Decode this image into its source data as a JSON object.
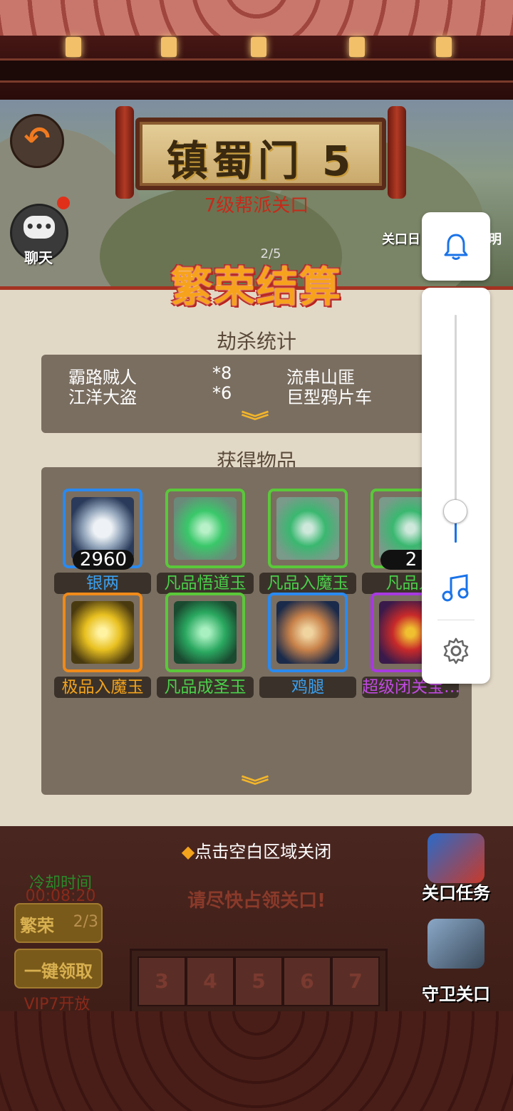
{
  "scene": {
    "banner_title": "镇蜀门 5",
    "banner_subtitle": "7级帮派关口",
    "chat_label": "聊天",
    "progress": "2/5",
    "sidebar_gate": "关口日",
    "sidebar_ming": "明"
  },
  "dialog": {
    "title": "繁荣结算",
    "kill_section_title": "劫杀统计",
    "kills": [
      {
        "name": "霸路贼人",
        "count": "*8"
      },
      {
        "name": "流串山匪",
        "count": ""
      },
      {
        "name": "江洋大盗",
        "count": "*6"
      },
      {
        "name": "巨型鸦片车",
        "count": ""
      }
    ],
    "items_section_title": "获得物品",
    "items": [
      {
        "name": "银两",
        "count": "2960",
        "name_color": "#3aa0f0",
        "frame": "#2a8af0",
        "icon": "silver-ingot-icon"
      },
      {
        "name": "凡品悟道玉",
        "count": "",
        "name_color": "#4ad04a",
        "frame": "#5ac83a",
        "icon": "green-crystal-jade-icon"
      },
      {
        "name": "凡品入魔玉",
        "count": "",
        "name_color": "#4ad04a",
        "frame": "#5ac83a",
        "icon": "green-crescent-jade-icon"
      },
      {
        "name": "凡品入",
        "count": "2",
        "name_color": "#4ad04a",
        "frame": "#5ac83a",
        "icon": "green-crescent-jade-icon"
      },
      {
        "name": "极品入魔玉",
        "count": "",
        "name_color": "#f3a31c",
        "frame": "#f08a1a",
        "icon": "gold-crescent-jade-icon"
      },
      {
        "name": "凡品成圣玉",
        "count": "",
        "name_color": "#4ad04a",
        "frame": "#5ac83a",
        "icon": "green-swirl-jade-icon"
      },
      {
        "name": "鸡腿",
        "count": "",
        "name_color": "#3aa0f0",
        "frame": "#2a8af0",
        "icon": "chicken-leg-icon"
      },
      {
        "name": "超级闭关宝…",
        "count": "",
        "name_color": "#c04ae0",
        "frame": "#a83ae0",
        "icon": "treasure-chest-icon"
      }
    ]
  },
  "bottom": {
    "close_hint_icon": "◆",
    "close_hint": "点击空白区域关闭",
    "cooldown_label": "冷却时间",
    "cooldown_time": "00:08:20",
    "prosper_label": "繁荣",
    "prosper_count": "2/3",
    "claim_label": "一键领取",
    "vip_label": "VIP7开放",
    "occupy_text": "请尽快占领关口!",
    "stages": [
      "3",
      "4",
      "5",
      "6",
      "7"
    ],
    "task_label": "关口任务",
    "guard_label": "守卫关口"
  },
  "overlay": {
    "bell_icon": "bell-icon",
    "music_icon": "music-note-icon",
    "settings_icon": "gear-icon",
    "volume_level": 0.14,
    "accent": "#1a73e8"
  }
}
